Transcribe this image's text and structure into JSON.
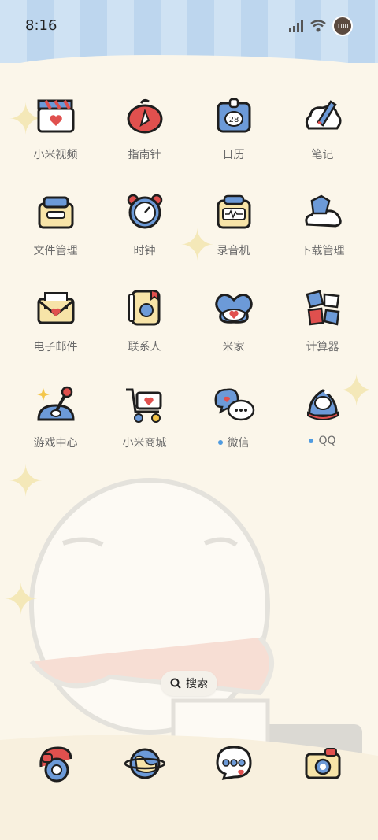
{
  "status": {
    "time": "8:16",
    "battery": "100"
  },
  "apps": [
    {
      "label": "小米视频",
      "icon": "video-icon",
      "dot": false
    },
    {
      "label": "指南针",
      "icon": "compass-icon",
      "dot": false
    },
    {
      "label": "日历",
      "icon": "calendar-icon",
      "dot": false,
      "badge": "28"
    },
    {
      "label": "笔记",
      "icon": "notes-icon",
      "dot": false
    },
    {
      "label": "文件管理",
      "icon": "file-manager-icon",
      "dot": false
    },
    {
      "label": "时钟",
      "icon": "clock-icon",
      "dot": false
    },
    {
      "label": "录音机",
      "icon": "recorder-icon",
      "dot": false
    },
    {
      "label": "下载管理",
      "icon": "downloads-icon",
      "dot": false
    },
    {
      "label": "电子邮件",
      "icon": "mail-icon",
      "dot": false
    },
    {
      "label": "联系人",
      "icon": "contacts-icon",
      "dot": false
    },
    {
      "label": "米家",
      "icon": "mijia-icon",
      "dot": false
    },
    {
      "label": "计算器",
      "icon": "calculator-icon",
      "dot": false
    },
    {
      "label": "游戏中心",
      "icon": "game-center-icon",
      "dot": false
    },
    {
      "label": "小米商城",
      "icon": "mi-store-icon",
      "dot": false
    },
    {
      "label": "微信",
      "icon": "wechat-icon",
      "dot": true
    },
    {
      "label": "QQ",
      "icon": "qq-icon",
      "dot": true
    }
  ],
  "search": {
    "label": "搜索"
  },
  "dock": [
    {
      "icon": "phone-icon"
    },
    {
      "icon": "browser-icon"
    },
    {
      "icon": "messages-icon"
    },
    {
      "icon": "camera-icon"
    }
  ],
  "colors": {
    "accent_blue": "#6c9ad8",
    "accent_red": "#e0504e",
    "cream": "#fbf6ea",
    "outline": "#1e1e1e",
    "notify_dot": "#4f9be0"
  }
}
